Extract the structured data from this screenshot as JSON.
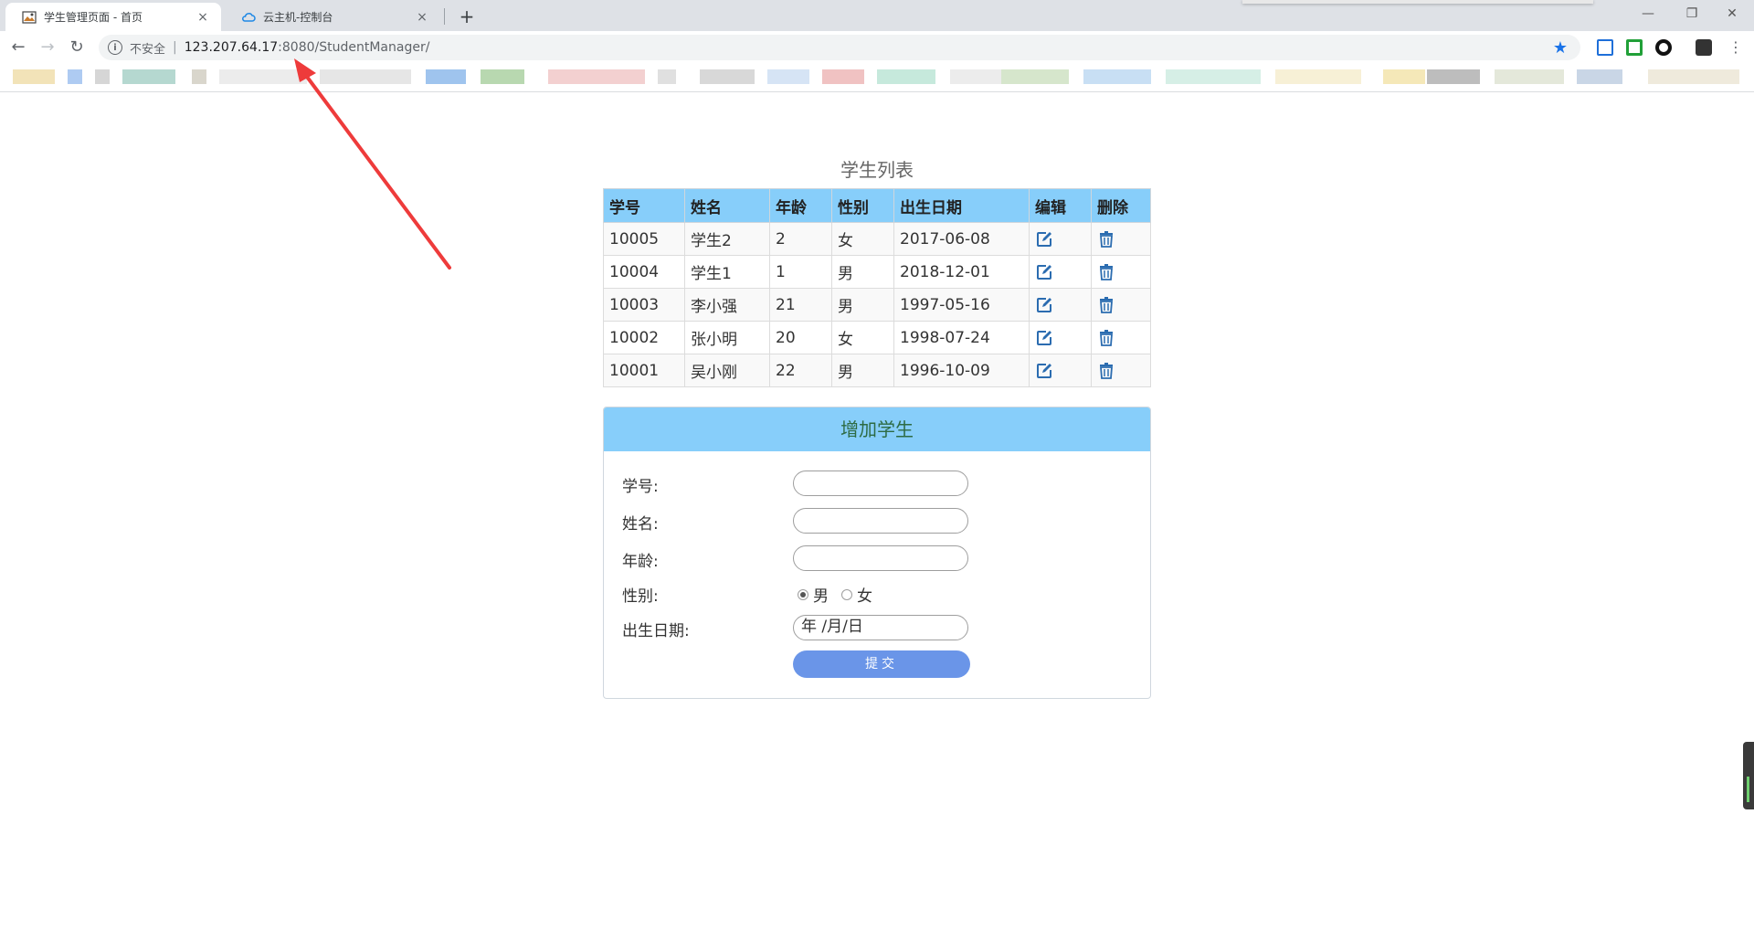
{
  "browser": {
    "tabs": [
      {
        "title": "学生管理页面 - 首页",
        "active": true,
        "favicon": "image-icon"
      },
      {
        "title": "云主机-控制台",
        "active": false,
        "favicon": "cloud-icon"
      }
    ],
    "close_glyph": "×",
    "new_tab_glyph": "+",
    "address": {
      "security_label": "不安全",
      "divider": "|",
      "host": "123.207.64.17",
      "path": ":8080/StudentManager/"
    }
  },
  "page": {
    "list_title": "学生列表",
    "table": {
      "headers": [
        "学号",
        "姓名",
        "年龄",
        "性别",
        "出生日期",
        "编辑",
        "删除"
      ],
      "rows": [
        {
          "id": "10005",
          "name": "学生2",
          "age": "2",
          "gender": "女",
          "birth": "2017-06-08"
        },
        {
          "id": "10004",
          "name": "学生1",
          "age": "1",
          "gender": "男",
          "birth": "2018-12-01"
        },
        {
          "id": "10003",
          "name": "李小强",
          "age": "21",
          "gender": "男",
          "birth": "1997-05-16"
        },
        {
          "id": "10002",
          "name": "张小明",
          "age": "20",
          "gender": "女",
          "birth": "1998-07-24"
        },
        {
          "id": "10001",
          "name": "吴小刚",
          "age": "22",
          "gender": "男",
          "birth": "1996-10-09"
        }
      ]
    },
    "add_form": {
      "title": "增加学生",
      "id_label": "学号:",
      "name_label": "姓名:",
      "age_label": "年龄:",
      "gender_label": "性别:",
      "gender_options": [
        "男",
        "女"
      ],
      "gender_selected": "男",
      "birth_label": "出生日期:",
      "birth_placeholder": "年 /月/日",
      "submit_label": "提交"
    }
  },
  "colors": {
    "header_bg": "#87cefa",
    "submit_bg": "#6a95e8",
    "icon_blue": "#2b6cb0",
    "arrow_red": "#ee3b3b"
  }
}
